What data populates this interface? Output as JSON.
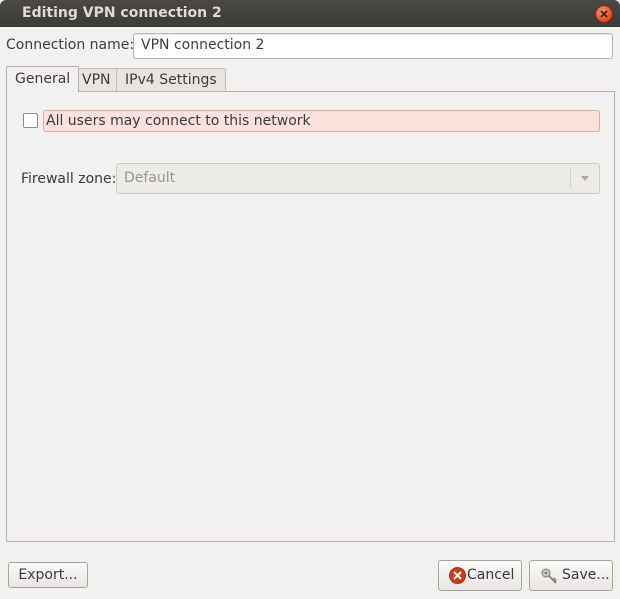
{
  "window": {
    "title": "Editing VPN connection 2"
  },
  "connection": {
    "label": "Connection name:",
    "value": "VPN connection 2"
  },
  "tabs": [
    {
      "label": "General",
      "active": true
    },
    {
      "label": "VPN",
      "active": false
    },
    {
      "label": "IPv4 Settings",
      "active": false
    }
  ],
  "general": {
    "all_users": {
      "label": "All users may connect to this network",
      "checked": false
    },
    "firewall": {
      "label": "Firewall zone:",
      "value": "Default"
    }
  },
  "buttons": {
    "export": "Export...",
    "cancel": "Cancel",
    "save": "Save..."
  },
  "icons": {
    "close": "close-icon",
    "cancel": "cancel-icon",
    "save": "keys-icon",
    "dropdown": "chevron-down-icon"
  },
  "colors": {
    "titlebar": "#3c3b37",
    "close": "#df4a16",
    "highlight": "#f9e1dc"
  }
}
